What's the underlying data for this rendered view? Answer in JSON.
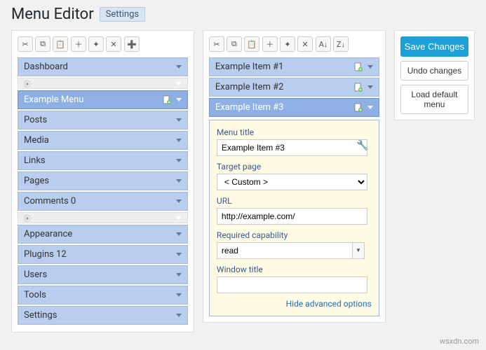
{
  "header": {
    "title": "Menu Editor",
    "settings_tab": "Settings"
  },
  "toolbar_icons": {
    "cut": "✂",
    "copy": "⧉",
    "paste": "📋",
    "new": "＋",
    "new_sep": "✦",
    "delete": "✕",
    "add": "➕",
    "sort_az": "A↓",
    "sort_za": "Z↓"
  },
  "left_menu": [
    {
      "type": "item",
      "label": "Dashboard",
      "selected": false,
      "has_page_icon": false
    },
    {
      "type": "separator"
    },
    {
      "type": "item",
      "label": "Example Menu",
      "selected": true,
      "has_page_icon": true
    },
    {
      "type": "item",
      "label": "Posts",
      "selected": false,
      "has_page_icon": false
    },
    {
      "type": "item",
      "label": "Media",
      "selected": false,
      "has_page_icon": false
    },
    {
      "type": "item",
      "label": "Links",
      "selected": false,
      "has_page_icon": false
    },
    {
      "type": "item",
      "label": "Pages",
      "selected": false,
      "has_page_icon": false
    },
    {
      "type": "item",
      "label": "Comments 0",
      "selected": false,
      "has_page_icon": false
    },
    {
      "type": "separator"
    },
    {
      "type": "item",
      "label": "Appearance",
      "selected": false,
      "has_page_icon": false
    },
    {
      "type": "item",
      "label": "Plugins 12",
      "selected": false,
      "has_page_icon": false
    },
    {
      "type": "item",
      "label": "Users",
      "selected": false,
      "has_page_icon": false
    },
    {
      "type": "item",
      "label": "Tools",
      "selected": false,
      "has_page_icon": false
    },
    {
      "type": "item",
      "label": "Settings",
      "selected": false,
      "has_page_icon": false
    }
  ],
  "right_menu": [
    {
      "label": "Example Item #1",
      "selected": false,
      "has_page_icon": true
    },
    {
      "label": "Example Item #2",
      "selected": false,
      "has_page_icon": true
    },
    {
      "label": "Example Item #3",
      "selected": true,
      "has_page_icon": true
    }
  ],
  "editor": {
    "menu_title": {
      "label": "Menu title",
      "value": "Example Item #3"
    },
    "target_page": {
      "label": "Target page",
      "value": "< Custom >"
    },
    "url": {
      "label": "URL",
      "value": "http://example.com/"
    },
    "required_capability": {
      "label": "Required capability",
      "value": "read"
    },
    "window_title": {
      "label": "Window title",
      "value": ""
    },
    "hide_link": "Hide advanced options"
  },
  "save_panel": {
    "save": "Save Changes",
    "undo": "Undo changes",
    "load_default": "Load default menu"
  },
  "watermark": "wsxdn.com"
}
